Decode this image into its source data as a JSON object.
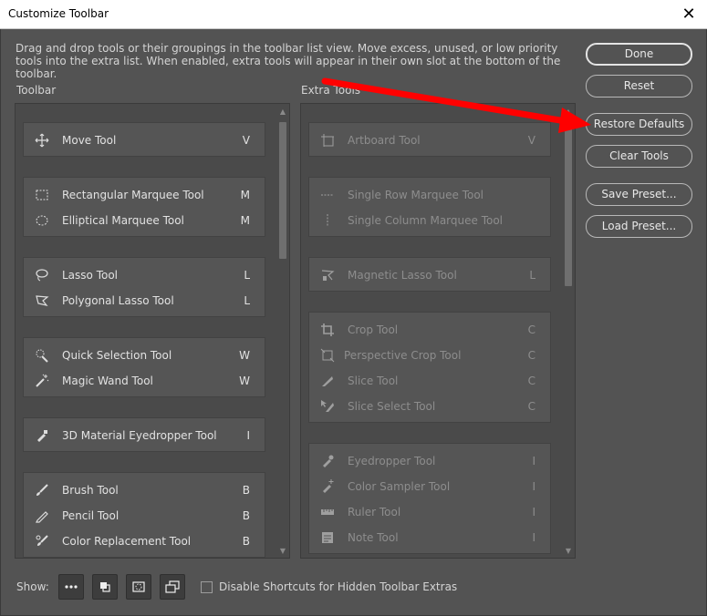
{
  "window": {
    "title": "Customize Toolbar",
    "close": "✕"
  },
  "description": "Drag and drop tools or their groupings in the toolbar list view. Move excess, unused, or low priority tools into the extra list. When enabled, extra tools will appear in their own slot at the bottom of the toolbar.",
  "labels": {
    "toolbar": "Toolbar",
    "extra": "Extra Tools"
  },
  "toolbar_groups": [
    [
      {
        "name": "Move Tool",
        "key": "V",
        "icon": "move-icon"
      }
    ],
    [
      {
        "name": "Rectangular Marquee Tool",
        "key": "M",
        "icon": "rect-marquee-icon"
      },
      {
        "name": "Elliptical Marquee Tool",
        "key": "M",
        "icon": "ellipse-marquee-icon"
      }
    ],
    [
      {
        "name": "Lasso Tool",
        "key": "L",
        "icon": "lasso-icon"
      },
      {
        "name": "Polygonal Lasso Tool",
        "key": "L",
        "icon": "polygonal-lasso-icon"
      }
    ],
    [
      {
        "name": "Quick Selection Tool",
        "key": "W",
        "icon": "quick-selection-icon"
      },
      {
        "name": "Magic Wand Tool",
        "key": "W",
        "icon": "magic-wand-icon"
      }
    ],
    [
      {
        "name": "3D Material Eyedropper Tool",
        "key": "I",
        "icon": "eyedropper-3d-icon"
      }
    ],
    [
      {
        "name": "Brush Tool",
        "key": "B",
        "icon": "brush-icon"
      },
      {
        "name": "Pencil Tool",
        "key": "B",
        "icon": "pencil-icon"
      },
      {
        "name": "Color Replacement Tool",
        "key": "B",
        "icon": "color-replacement-icon"
      }
    ]
  ],
  "extra_groups": [
    [
      {
        "name": "Artboard Tool",
        "key": "V",
        "icon": "artboard-icon"
      }
    ],
    [
      {
        "name": "Single Row Marquee Tool",
        "key": "",
        "icon": "single-row-icon"
      },
      {
        "name": "Single Column Marquee Tool",
        "key": "",
        "icon": "single-column-icon"
      }
    ],
    [
      {
        "name": "Magnetic Lasso Tool",
        "key": "L",
        "icon": "magnetic-lasso-icon"
      }
    ],
    [
      {
        "name": "Crop Tool",
        "key": "C",
        "icon": "crop-icon"
      },
      {
        "name": "Perspective Crop Tool",
        "key": "C",
        "icon": "perspective-crop-icon"
      },
      {
        "name": "Slice Tool",
        "key": "C",
        "icon": "slice-icon"
      },
      {
        "name": "Slice Select Tool",
        "key": "C",
        "icon": "slice-select-icon"
      }
    ],
    [
      {
        "name": "Eyedropper Tool",
        "key": "I",
        "icon": "eyedropper-icon"
      },
      {
        "name": "Color Sampler Tool",
        "key": "I",
        "icon": "color-sampler-icon"
      },
      {
        "name": "Ruler Tool",
        "key": "I",
        "icon": "ruler-icon"
      },
      {
        "name": "Note Tool",
        "key": "I",
        "icon": "note-icon"
      }
    ]
  ],
  "buttons": {
    "done": "Done",
    "reset": "Reset",
    "restore": "Restore Defaults",
    "clear": "Clear Tools",
    "save_preset": "Save Preset...",
    "load_preset": "Load Preset..."
  },
  "footer": {
    "show_label": "Show:",
    "checkbox_label": "Disable Shortcuts for Hidden Toolbar Extras",
    "checkbox_checked": false
  },
  "annotation": {
    "arrow_color": "#ff0000"
  }
}
